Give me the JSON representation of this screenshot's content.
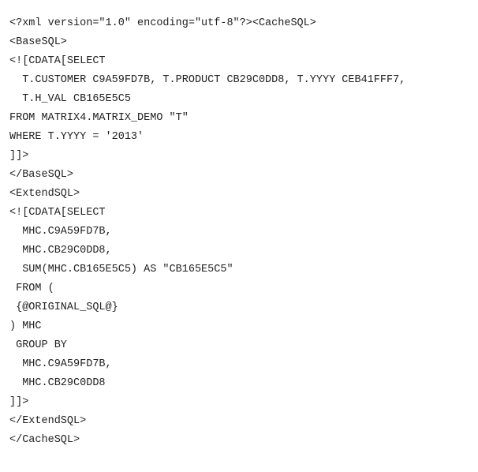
{
  "code": {
    "lines": [
      "<?xml version=\"1.0\" encoding=\"utf-8\"?><CacheSQL>",
      "<BaseSQL>",
      "<![CDATA[SELECT",
      "  T.CUSTOMER C9A59FD7B, T.PRODUCT CB29C0DD8, T.YYYY CEB41FFF7,",
      "  T.H_VAL CB165E5C5",
      "FROM MATRIX4.MATRIX_DEMO \"T\"",
      "WHERE T.YYYY = '2013'",
      "]]>",
      "</BaseSQL>",
      "<ExtendSQL>",
      "<![CDATA[SELECT",
      "  MHC.C9A59FD7B,",
      "  MHC.CB29C0DD8,",
      "  SUM(MHC.CB165E5C5) AS \"CB165E5C5\"",
      " FROM (",
      " {@ORIGINAL_SQL@}",
      ") MHC",
      " GROUP BY",
      "  MHC.C9A59FD7B,",
      "  MHC.CB29C0DD8",
      "]]>",
      "</ExtendSQL>",
      "</CacheSQL>"
    ]
  }
}
